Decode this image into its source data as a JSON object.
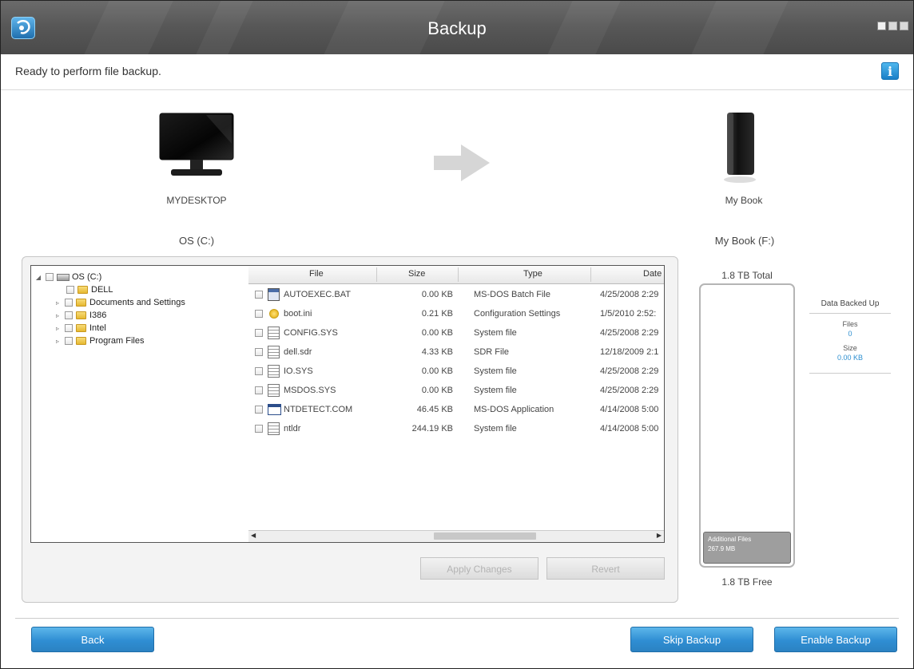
{
  "title": "Backup",
  "status_text": "Ready to perform file backup.",
  "source": {
    "computer_name": "MYDESKTOP",
    "drive_label": "OS (C:)",
    "tree": [
      {
        "label": "OS (C:)"
      },
      {
        "label": "DELL"
      },
      {
        "label": "Documents and Settings"
      },
      {
        "label": "I386"
      },
      {
        "label": "Intel"
      },
      {
        "label": "Program Files"
      }
    ],
    "columns": [
      "File",
      "Size",
      "Type",
      "Date"
    ],
    "files": [
      {
        "name": "AUTOEXEC.BAT",
        "size": "0.00 KB",
        "type": "MS-DOS Batch File",
        "date": "4/25/2008 2:29",
        "icon": "batch-file-icon"
      },
      {
        "name": "boot.ini",
        "size": "0.21 KB",
        "type": "Configuration Settings",
        "date": "1/5/2010 2:52:",
        "icon": "settings-file-icon"
      },
      {
        "name": "CONFIG.SYS",
        "size": "0.00 KB",
        "type": "System file",
        "date": "4/25/2008 2:29",
        "icon": "system-file-icon"
      },
      {
        "name": "dell.sdr",
        "size": "4.33 KB",
        "type": "SDR File",
        "date": "12/18/2009 2:1",
        "icon": "system-file-icon"
      },
      {
        "name": "IO.SYS",
        "size": "0.00 KB",
        "type": "System file",
        "date": "4/25/2008 2:29",
        "icon": "system-file-icon"
      },
      {
        "name": "MSDOS.SYS",
        "size": "0.00 KB",
        "type": "System file",
        "date": "4/25/2008 2:29",
        "icon": "system-file-icon"
      },
      {
        "name": "NTDETECT.COM",
        "size": "46.45 KB",
        "type": "MS-DOS Application",
        "date": "4/14/2008 5:00",
        "icon": "application-file-icon"
      },
      {
        "name": "ntldr",
        "size": "244.19 KB",
        "type": "System file",
        "date": "4/14/2008 5:00",
        "icon": "system-file-icon"
      }
    ],
    "apply_label": "Apply Changes",
    "revert_label": "Revert"
  },
  "destination": {
    "device_name": "My Book",
    "drive_label": "My Book (F:)",
    "total": "1.8 TB Total",
    "free": "1.8 TB Free",
    "additional_files": "Additional Files",
    "additional_size": "267.9 MB"
  },
  "data_backed_up": {
    "title": "Data Backed Up",
    "files_label": "Files",
    "files_value": "0",
    "size_label": "Size",
    "size_value": "0.00 KB"
  },
  "buttons": {
    "back": "Back",
    "skip": "Skip Backup",
    "enable": "Enable Backup"
  },
  "colors": {
    "accent_blue": "#2f8ed3",
    "title_bar": "#585858",
    "link_value": "#2d8fd0"
  }
}
